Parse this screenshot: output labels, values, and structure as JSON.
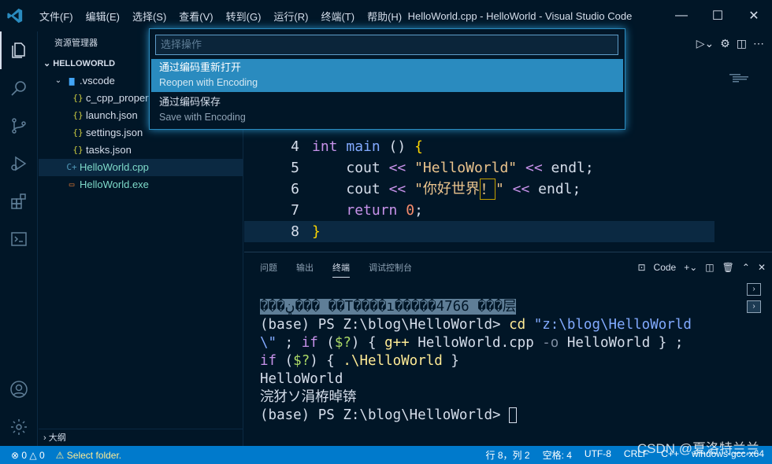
{
  "titlebar": {
    "menu": [
      "文件(F)",
      "编辑(E)",
      "选择(S)",
      "查看(V)",
      "转到(G)",
      "运行(R)",
      "终端(T)",
      "帮助(H)"
    ],
    "title": "HelloWorld.cpp - HelloWorld - Visual Studio Code"
  },
  "sidebar": {
    "title": "资源管理器",
    "section": "HELLOWORLD",
    "items": [
      {
        "label": ".vscode"
      },
      {
        "label": "c_cpp_properties.json"
      },
      {
        "label": "launch.json"
      },
      {
        "label": "settings.json"
      },
      {
        "label": "tasks.json"
      },
      {
        "label": "HelloWorld.cpp"
      },
      {
        "label": "HelloWorld.exe"
      }
    ],
    "outline": "大纲"
  },
  "quickpick": {
    "placeholder": "选择操作",
    "items": [
      {
        "title": "通过编码重新打开",
        "subtitle": "Reopen with Encoding"
      },
      {
        "title": "通过编码保存",
        "subtitle": "Save with Encoding"
      }
    ]
  },
  "editor": {
    "lines": [
      {
        "n": "4",
        "k1": "int",
        "f": "main",
        "p": " () ",
        "b": "{"
      },
      {
        "n": "5",
        "a": "cout",
        "o1": "<<",
        "s": "\"HelloWorld\"",
        "o2": "<<",
        "e": "endl;"
      },
      {
        "n": "6",
        "a": "cout",
        "o1": "<<",
        "s1": "\"你好世界",
        "s2": "！",
        "s3": "\"",
        "o2": "<<",
        "e": "endl;"
      },
      {
        "n": "7",
        "r": "return",
        "num": "0",
        "semi": ";"
      },
      {
        "n": "8",
        "b": "}"
      }
    ]
  },
  "panel": {
    "tabs": [
      "问题",
      "输出",
      "终端",
      "调试控制台"
    ],
    "active_tab": "终端",
    "terminal_profile": "Code",
    "terminal": {
      "garbled": "���ڼ��� ��T����ı�����4766 ���层",
      "prompt": "(base) PS Z:\\blog\\HelloWorld> ",
      "cmd1": "cd",
      "str1": "\"z:\\blog\\HelloWorld",
      "str2": "\\\"",
      "rest1": " ; ",
      "if1": "if",
      "cond1": " (",
      "q1": "$?",
      "cond1b": ") { ",
      "gpp": "g++",
      "args": " HelloWorld.cpp ",
      "flag": "-o",
      "args2": " HelloWorld } ;",
      "if2": "if",
      "cond2": " (",
      "q2": "$?",
      "cond2b": ") { ",
      "run": ".\\HelloWorld",
      "close2": " }",
      "out1": "HelloWorld",
      "out2": "浣犲ソ涓栫晫锛",
      "prompt2": "(base) PS Z:\\blog\\HelloWorld> "
    }
  },
  "statusbar": {
    "errors": "0",
    "warnings": "0",
    "select_folder": "Select folder.",
    "position": "行 8，列 2",
    "spaces": "空格: 4",
    "encoding": "UTF-8",
    "eol": "CRLF",
    "language": "C++",
    "config": "windows-gcc-x64"
  },
  "watermark": "CSDN @夏洛特兰兰",
  "colors": {
    "accent": "#007acc",
    "quickpick_highlight": "#2a8bbf",
    "background": "#011627"
  }
}
